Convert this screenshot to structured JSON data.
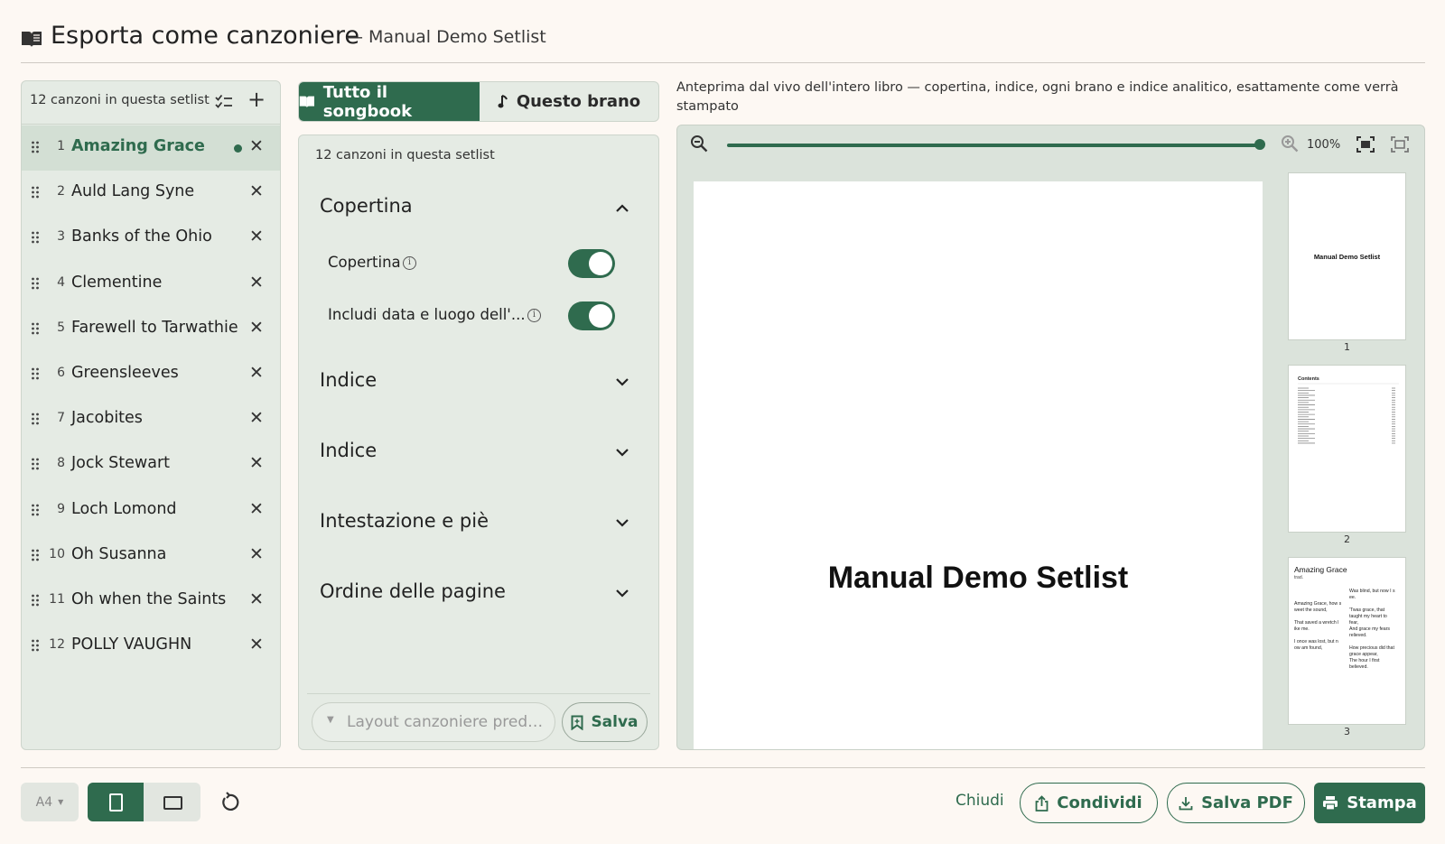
{
  "header": {
    "title": "Esporta come canzoniere",
    "subtitle": "— Manual Demo Setlist"
  },
  "setlist": {
    "count_label": "12 canzoni in questa setlist",
    "songs": [
      {
        "num": "1",
        "name": "Amazing Grace"
      },
      {
        "num": "2",
        "name": "Auld Lang Syne"
      },
      {
        "num": "3",
        "name": "Banks of the Ohio"
      },
      {
        "num": "4",
        "name": "Clementine"
      },
      {
        "num": "5",
        "name": "Farewell to Tarwathie"
      },
      {
        "num": "6",
        "name": "Greensleeves"
      },
      {
        "num": "7",
        "name": "Jacobites"
      },
      {
        "num": "8",
        "name": "Jock Stewart"
      },
      {
        "num": "9",
        "name": "Loch Lomond"
      },
      {
        "num": "10",
        "name": "Oh Susanna"
      },
      {
        "num": "11",
        "name": "Oh when the Saints"
      },
      {
        "num": "12",
        "name": "POLLY VAUGHN"
      }
    ],
    "selected_index": 0,
    "remove_glyph": "✕",
    "add_glyph": "+"
  },
  "tabs": {
    "whole": "Tutto il songbook",
    "song": "Questo brano"
  },
  "options": {
    "count_label": "12 canzoni in questa setlist",
    "sections": {
      "cover": "Copertina",
      "index1": "Indice",
      "index2": "Indice",
      "header_footer": "Intestazione e piè",
      "page_order": "Ordine delle pagine"
    },
    "cover_toggle": {
      "label": "Copertina",
      "on": true
    },
    "date_toggle": {
      "label": "Includi data e luogo dell'...",
      "on": true
    },
    "layout_placeholder": "Layout canzoniere prede...",
    "save_label": "Salva"
  },
  "preview": {
    "hint": "Anteprima dal vivo dell'intero libro — copertina, indice, ogni brano e indice analitico, esattamente come verrà stampato",
    "zoom_label": "100%",
    "zoom_fraction": 1.0,
    "cover_title": "Manual Demo Setlist",
    "thumbnails": [
      {
        "num": "1",
        "title": "Manual Demo Setlist"
      },
      {
        "num": "2",
        "title": "Contents"
      },
      {
        "num": "3",
        "title": "Amazing Grace",
        "subtitle": "trad."
      }
    ],
    "thumb3_left_lyrics": "Amazing Grace, how s\nweet the sound,\n\nThat saved a wretch l\nike me.\n\nI once was lost, but n\now am found,",
    "thumb3_right_lyrics": "Was blind, but now I s\nee.\n\n'Twas grace, that\ntaught my heart to\nfear,\nAnd grace my fears\nrelieved.\n\nHow precious did that\ngrace appear,\nThe hour I first\nbelieved."
  },
  "footer": {
    "page_size": "A4",
    "close_label": "Chiudi",
    "share_label": "Condividi",
    "save_pdf_label": "Salva PDF",
    "print_label": "Stampa"
  },
  "colors": {
    "accent": "#2f6b4e",
    "panel": "#e5ebe4",
    "background": "#fdf8f3"
  },
  "icons": [
    "book-icon",
    "checklist-icon",
    "plus-icon",
    "grip-icon",
    "close-icon",
    "music-note-icon",
    "chevron-up-icon",
    "chevron-down-icon",
    "info-icon",
    "bookmark-add-icon",
    "zoom-out-icon",
    "zoom-in-icon",
    "fit-page-icon",
    "fit-width-icon",
    "portrait-icon",
    "landscape-icon",
    "reset-icon",
    "share-icon",
    "download-icon",
    "printer-icon"
  ]
}
